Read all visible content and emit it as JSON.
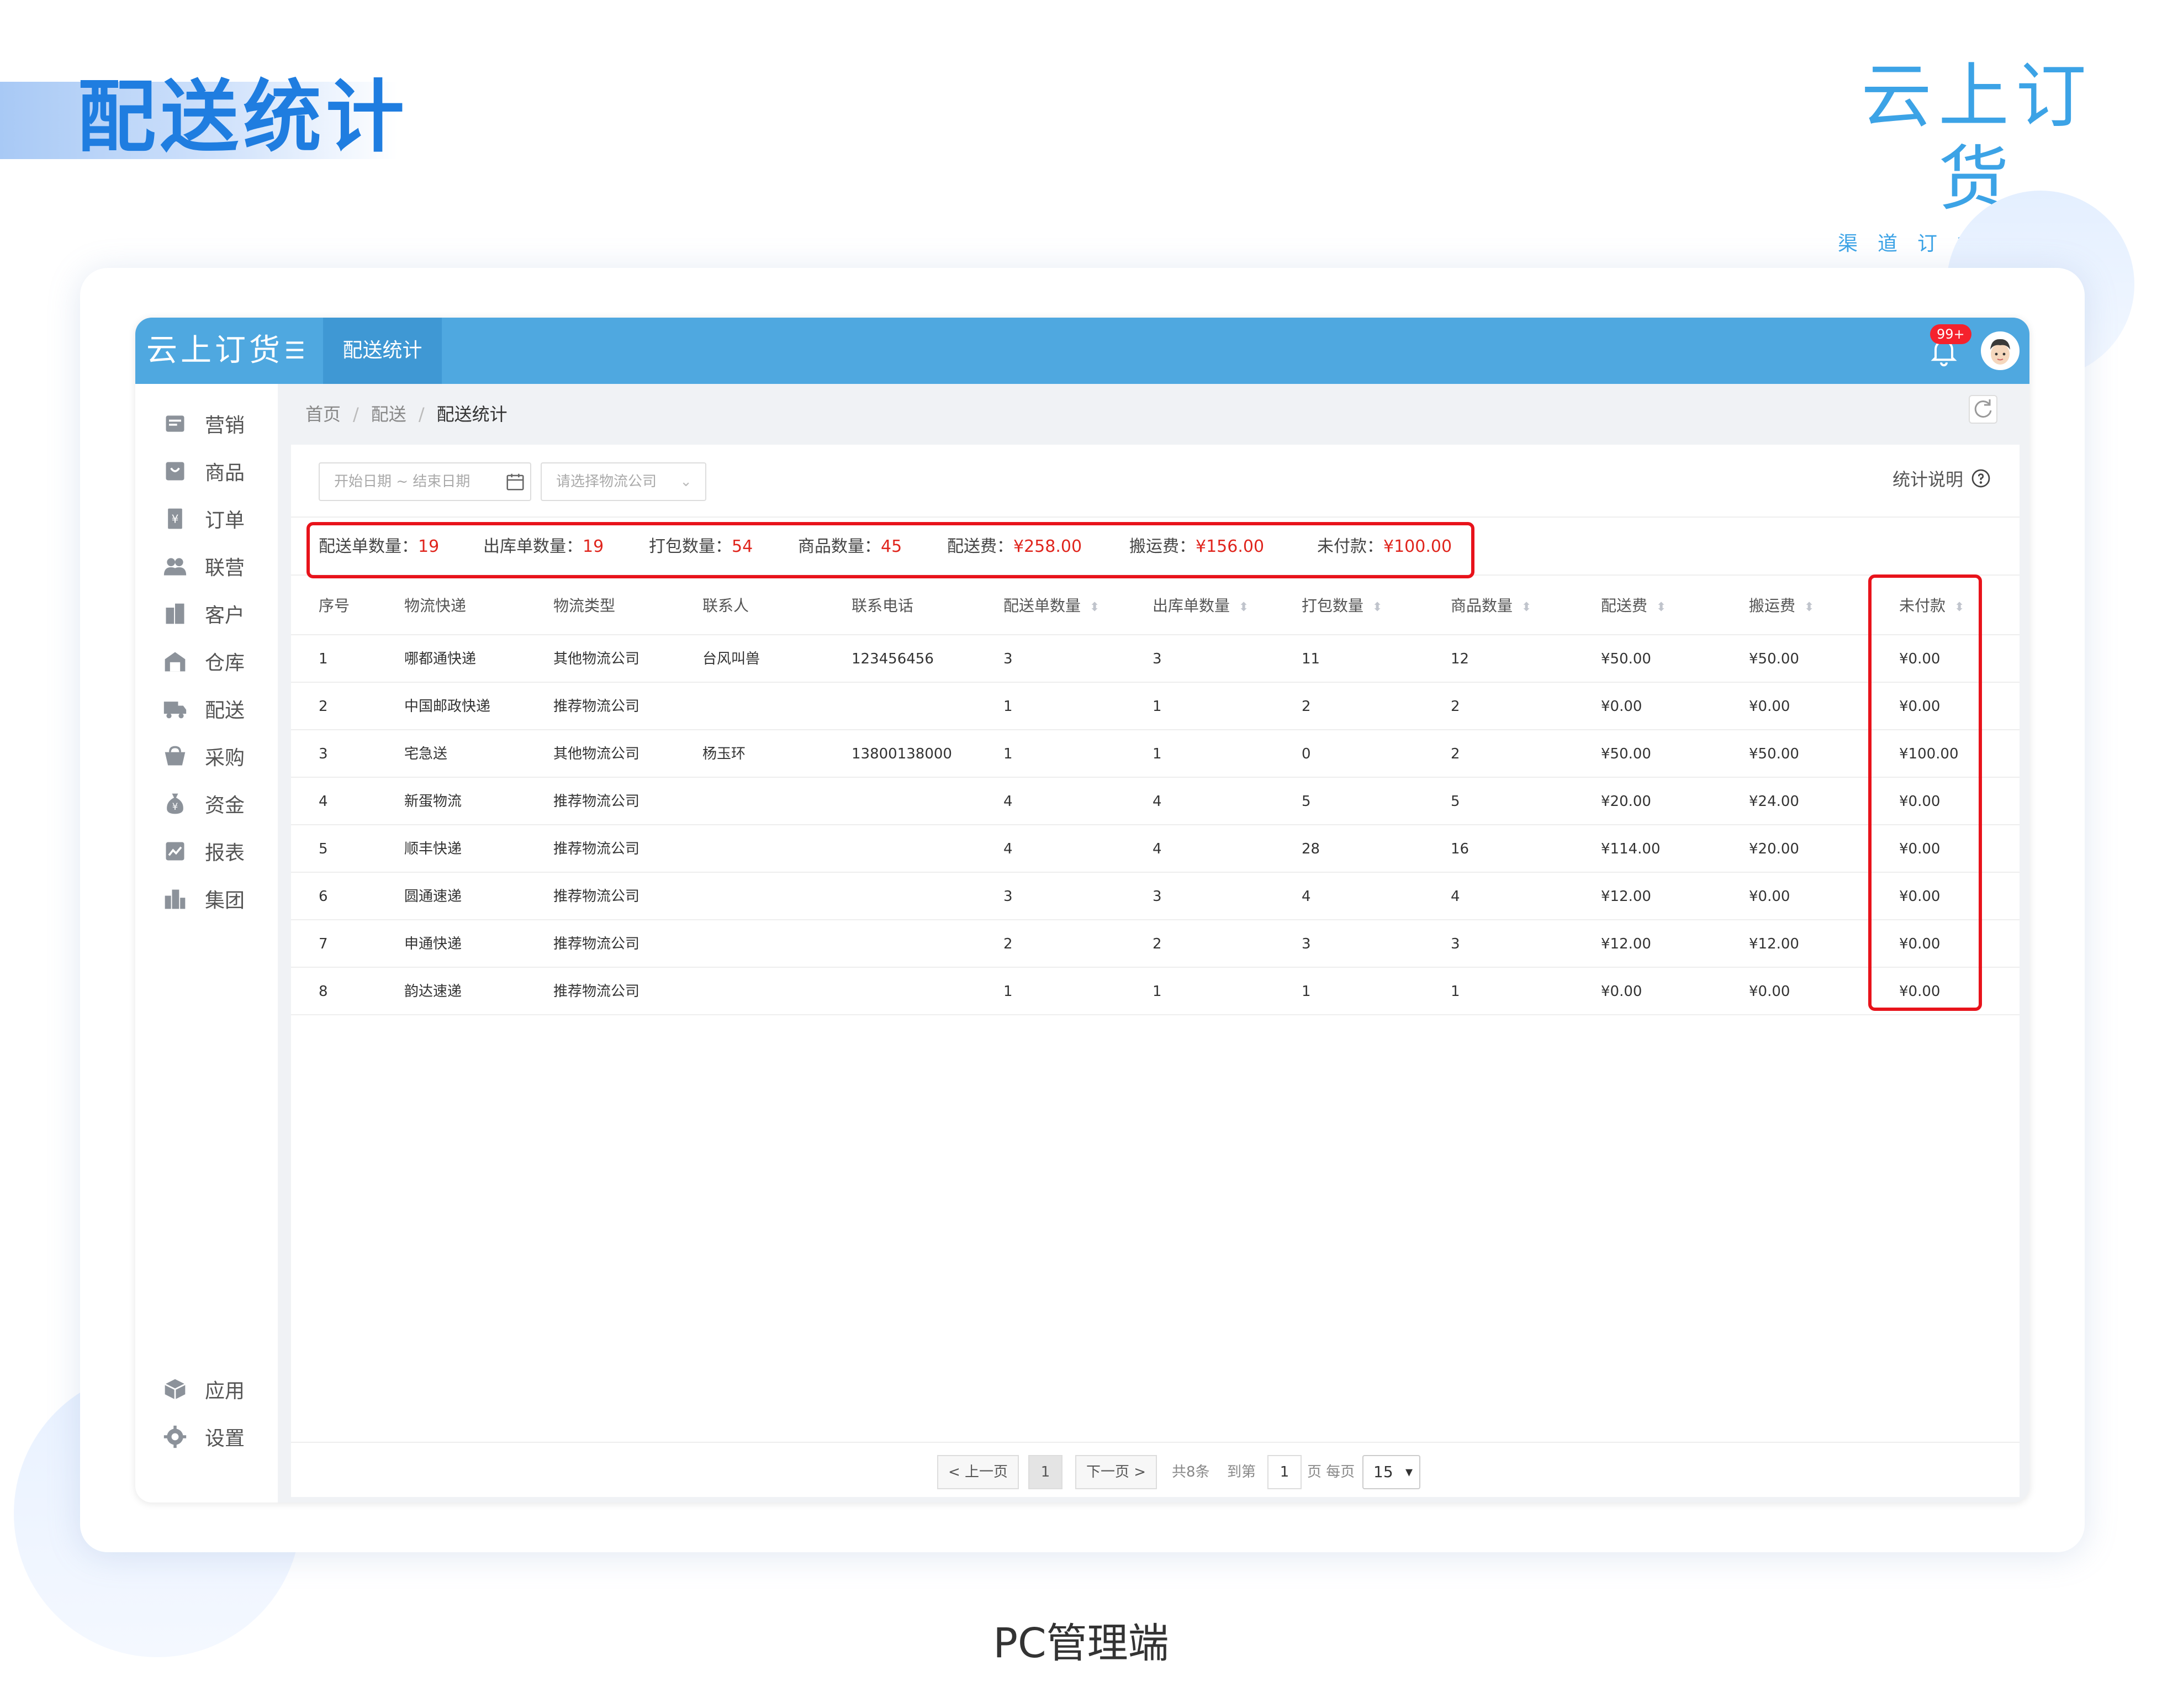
{
  "page": {
    "title": "配送统计",
    "brand_name": "云上订货",
    "brand_slogan": "渠道订货更方便",
    "caption": "PC管理端"
  },
  "topbar": {
    "logo": "云上订货",
    "active_tab": "配送统计",
    "notification_badge": "99+"
  },
  "sidebar": {
    "items": [
      {
        "label": "营销",
        "icon": "marketing-icon"
      },
      {
        "label": "商品",
        "icon": "goods-icon"
      },
      {
        "label": "订单",
        "icon": "order-icon"
      },
      {
        "label": "联营",
        "icon": "partner-icon"
      },
      {
        "label": "客户",
        "icon": "customer-icon"
      },
      {
        "label": "仓库",
        "icon": "warehouse-icon"
      },
      {
        "label": "配送",
        "icon": "delivery-icon"
      },
      {
        "label": "采购",
        "icon": "purchase-icon"
      },
      {
        "label": "资金",
        "icon": "fund-icon"
      },
      {
        "label": "报表",
        "icon": "report-icon"
      },
      {
        "label": "集团",
        "icon": "group-icon"
      }
    ],
    "bottom_items": [
      {
        "label": "应用",
        "icon": "app-icon"
      },
      {
        "label": "设置",
        "icon": "settings-icon"
      }
    ]
  },
  "breadcrumb": [
    "首页",
    "配送",
    "配送统计"
  ],
  "filters": {
    "date_placeholder": "开始日期 ~ 结束日期",
    "company_placeholder": "请选择物流公司",
    "explain_label": "统计说明"
  },
  "summary": [
    {
      "label": "配送单数量：",
      "value": "19"
    },
    {
      "label": "出库单数量：",
      "value": "19"
    },
    {
      "label": "打包数量：",
      "value": "54"
    },
    {
      "label": "商品数量：",
      "value": "45"
    },
    {
      "label": "配送费：",
      "value": "¥258.00"
    },
    {
      "label": "搬运费：",
      "value": "¥156.00"
    },
    {
      "label": "未付款：",
      "value": "¥100.00"
    }
  ],
  "table": {
    "columns": [
      "序号",
      "物流快递",
      "物流类型",
      "联系人",
      "联系电话",
      "配送单数量",
      "出库单数量",
      "打包数量",
      "商品数量",
      "配送费",
      "搬运费",
      "未付款"
    ],
    "rows": [
      [
        "1",
        "哪都通快递",
        "其他物流公司",
        "台风叫兽",
        "123456456",
        "3",
        "3",
        "11",
        "12",
        "¥50.00",
        "¥50.00",
        "¥0.00"
      ],
      [
        "2",
        "中国邮政快递",
        "推荐物流公司",
        "",
        "",
        "1",
        "1",
        "2",
        "2",
        "¥0.00",
        "¥0.00",
        "¥0.00"
      ],
      [
        "3",
        "宅急送",
        "其他物流公司",
        "杨玉环",
        "13800138000",
        "1",
        "1",
        "0",
        "2",
        "¥50.00",
        "¥50.00",
        "¥100.00"
      ],
      [
        "4",
        "新蛋物流",
        "推荐物流公司",
        "",
        "",
        "4",
        "4",
        "5",
        "5",
        "¥20.00",
        "¥24.00",
        "¥0.00"
      ],
      [
        "5",
        "顺丰快递",
        "推荐物流公司",
        "",
        "",
        "4",
        "4",
        "28",
        "16",
        "¥114.00",
        "¥20.00",
        "¥0.00"
      ],
      [
        "6",
        "圆通速递",
        "推荐物流公司",
        "",
        "",
        "3",
        "3",
        "4",
        "4",
        "¥12.00",
        "¥0.00",
        "¥0.00"
      ],
      [
        "7",
        "申通快递",
        "推荐物流公司",
        "",
        "",
        "2",
        "2",
        "3",
        "3",
        "¥12.00",
        "¥12.00",
        "¥0.00"
      ],
      [
        "8",
        "韵达速递",
        "推荐物流公司",
        "",
        "",
        "1",
        "1",
        "1",
        "1",
        "¥0.00",
        "¥0.00",
        "¥0.00"
      ]
    ]
  },
  "pagination": {
    "prev": "< 上一页",
    "current": "1",
    "next": "下一页 >",
    "total": "共8条",
    "goto_label": "到第",
    "goto_value": "1",
    "per_page_label": "页 每页",
    "per_page": "15"
  },
  "colors": {
    "accent": "#4fa8e0",
    "title_blue": "#1f7de0",
    "highlight_red": "#e8131b",
    "value_red": "#e0251d"
  }
}
